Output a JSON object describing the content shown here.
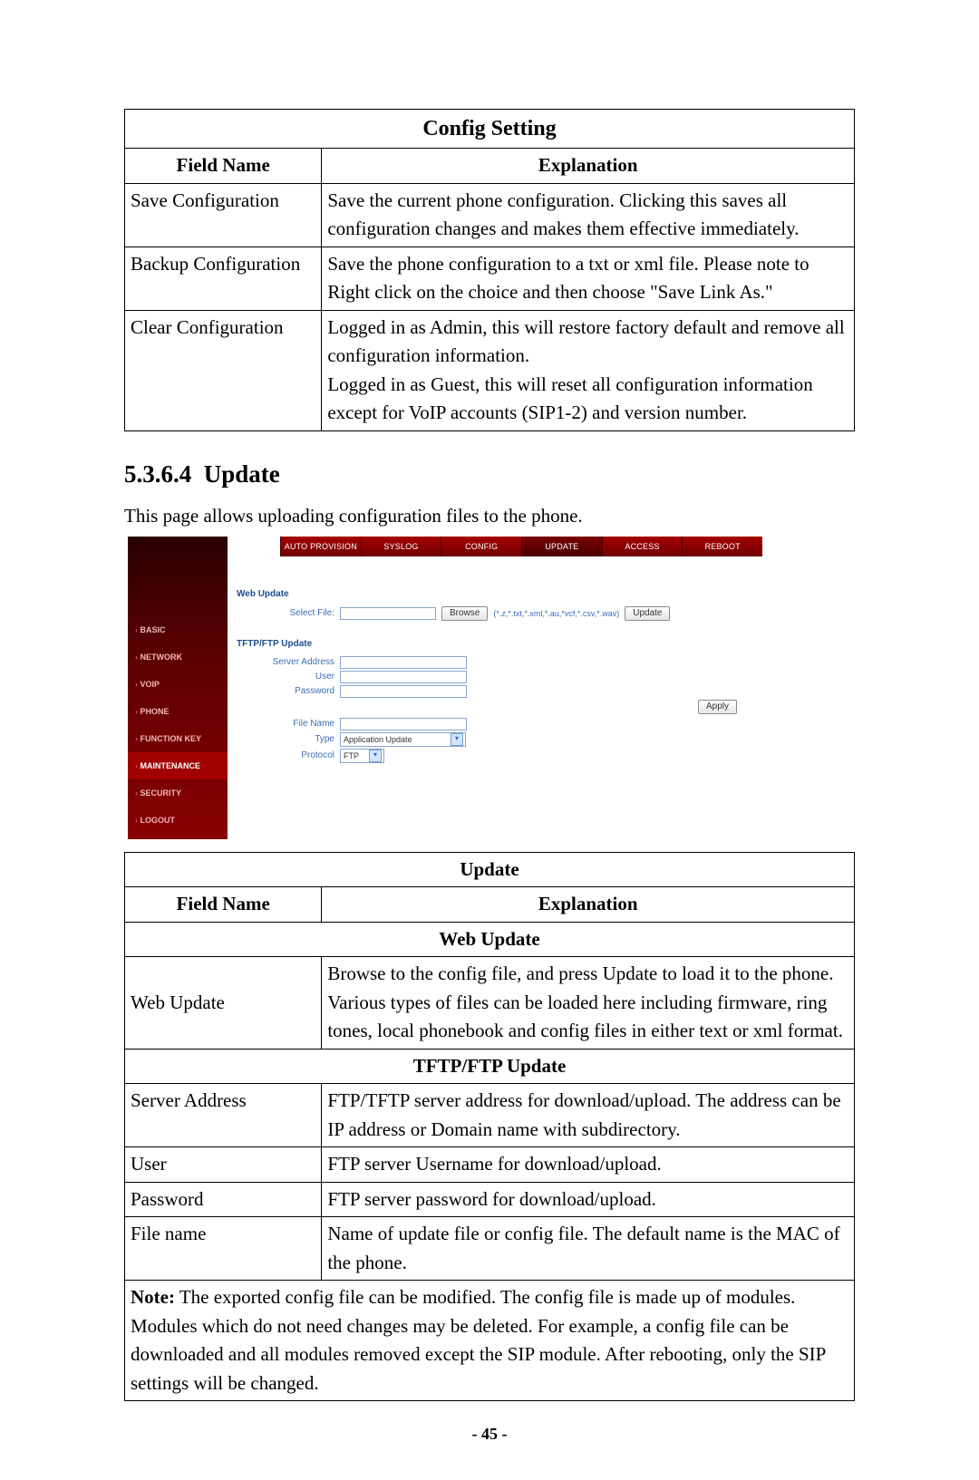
{
  "config_table": {
    "title": "Config Setting",
    "header_field": "Field Name",
    "header_explanation": "Explanation",
    "rows": [
      {
        "field": "Save Configuration",
        "explanation": "Save the current phone configuration. Clicking this saves all configuration changes and makes them effective immediately."
      },
      {
        "field": "Backup Configuration",
        "explanation": "Save the phone configuration to a txt or xml file.   Please note to Right click on the choice and then choose \"Save Link As.\""
      },
      {
        "field": "Clear Configuration",
        "explanation": "Logged in as Admin, this will restore factory default and remove all configuration information.\nLogged in as Guest, this will reset all configuration information except for VoIP accounts (SIP1-2) and version number."
      }
    ]
  },
  "section": {
    "number": "5.3.6.4",
    "title": "Update",
    "intro": "This page allows uploading configuration files to the phone."
  },
  "ui": {
    "sidebar": {
      "items": [
        {
          "label": "BASIC"
        },
        {
          "label": "NETWORK"
        },
        {
          "label": "VOIP"
        },
        {
          "label": "PHONE"
        },
        {
          "label": "FUNCTION KEY"
        },
        {
          "label": "MAINTENANCE",
          "active": true
        },
        {
          "label": "SECURITY"
        },
        {
          "label": "LOGOUT"
        }
      ]
    },
    "tabs": [
      "AUTO PROVISION",
      "SYSLOG",
      "CONFIG",
      "UPDATE",
      "ACCESS",
      "REBOOT"
    ],
    "web_update": {
      "title": "Web Update",
      "select_file_label": "Select File:",
      "browse_btn": "Browse",
      "file_hint": "(*.z,*.txt,*.xml,*.au,*vcf,*.csv,*.wav)",
      "update_btn": "Update"
    },
    "tftp": {
      "title": "TFTP/FTP Update",
      "server_address_label": "Server Address",
      "user_label": "User",
      "password_label": "Password",
      "file_name_label": "File Name",
      "type_label": "Type",
      "type_value": "Application Update",
      "protocol_label": "Protocol",
      "protocol_value": "FTP",
      "apply_btn": "Apply"
    }
  },
  "update_table": {
    "title": "Update",
    "header_field": "Field Name",
    "header_explanation": "Explanation",
    "web_update_section": "Web Update",
    "web_update_field": "Web Update",
    "web_update_explanation": "Browse to the config file, and press Update to load it to the phone. Various types of files can be loaded here including firmware, ring tones, local phonebook and config files in either text or xml format.",
    "tftp_section": "TFTP/FTP Update",
    "rows": [
      {
        "field": "Server Address",
        "explanation": "FTP/TFTP server address for download/upload. The address can be IP address or Domain name with subdirectory."
      },
      {
        "field": "User",
        "explanation": "FTP server Username for download/upload."
      },
      {
        "field": "Password",
        "explanation": "FTP server password for download/upload."
      },
      {
        "field": "File name",
        "explanation": "Name of update file or config file. The default name is the MAC of the phone."
      }
    ],
    "note_label": "Note:",
    "note_text": " The exported config file can be modified.   The config file is made up of modules.   Modules which do not need changes may be deleted.   For example, a config file can be downloaded and all modules removed except the SIP module. After rebooting, only the SIP settings will be changed."
  },
  "page_number": "- 45 -"
}
